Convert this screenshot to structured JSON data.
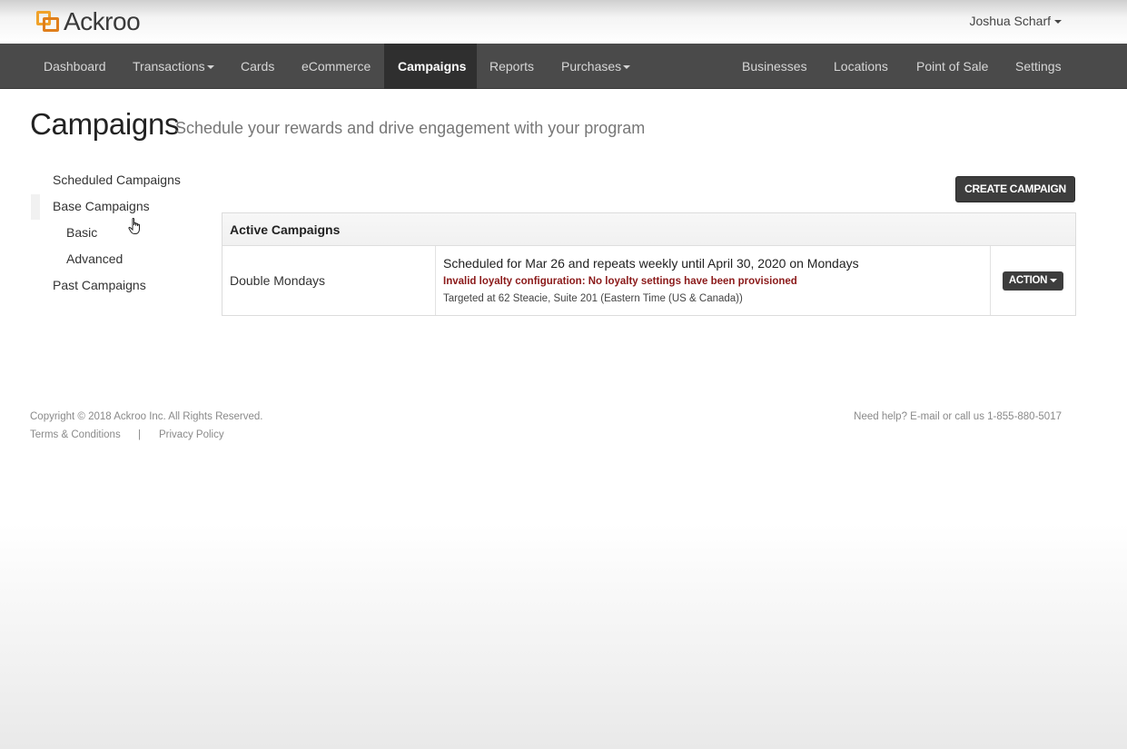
{
  "brand": {
    "name": "Ackroo"
  },
  "user": {
    "name": "Joshua Scharf"
  },
  "nav": {
    "items": [
      {
        "label": "Dashboard"
      },
      {
        "label": "Transactions"
      },
      {
        "label": "Cards"
      },
      {
        "label": "eCommerce"
      },
      {
        "label": "Campaigns"
      },
      {
        "label": "Reports"
      },
      {
        "label": "Purchases"
      },
      {
        "label": "Businesses"
      },
      {
        "label": "Locations"
      },
      {
        "label": "Point of Sale"
      },
      {
        "label": "Settings"
      }
    ],
    "active": "Campaigns"
  },
  "page": {
    "title": "Campaigns",
    "subtitle": "Schedule your rewards and drive engagement with your program"
  },
  "sidebar": {
    "items": [
      {
        "label": "Scheduled Campaigns"
      },
      {
        "label": "Base Campaigns"
      },
      {
        "label": "Basic"
      },
      {
        "label": "Advanced"
      },
      {
        "label": "Past Campaigns"
      }
    ]
  },
  "actions": {
    "create_label": "CREATE CAMPAIGN"
  },
  "table": {
    "heading": "Active Campaigns",
    "rows": [
      {
        "name": "Double Mondays",
        "schedule": "Scheduled for Mar 26 and repeats weekly until April 30, 2020 on Mondays",
        "error": "Invalid loyalty configuration: No loyalty settings have been provisioned",
        "target": "Targeted at 62 Steacie, Suite 201 (Eastern Time (US & Canada))",
        "action_label": "ACTION"
      }
    ]
  },
  "footer": {
    "copyright": "Copyright © 2018 Ackroo Inc. All Rights Reserved.",
    "terms": "Terms & Conditions",
    "separator": "|",
    "privacy": "Privacy Policy",
    "help": "Need help? E-mail or call us 1-855-880-5017"
  },
  "colors": {
    "nav_bg": "#4a4a4a",
    "nav_active": "#2f2f2f",
    "logo_orange": "#f0a22a",
    "error_red": "#8b1a1a",
    "button_dark": "#3d3d3d"
  }
}
